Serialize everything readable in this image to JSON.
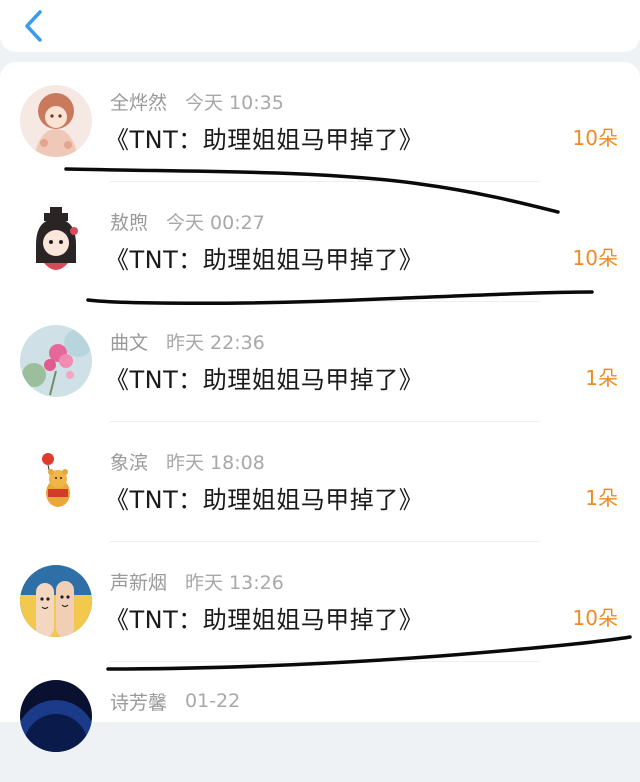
{
  "header": {
    "back_icon": "chevron-left-icon",
    "accent_color": "#3a9bf0"
  },
  "rows": [
    {
      "user": "全烨然",
      "time": "今天 10:35",
      "title": "《TNT：助理姐姐马甲掉了》",
      "count": "10朵",
      "avatar": "anime-girl-avatar"
    },
    {
      "user": "敖煦",
      "time": "今天 00:27",
      "title": "《TNT：助理姐姐马甲掉了》",
      "count": "10朵",
      "avatar": "chibi-girl-avatar"
    },
    {
      "user": "曲文",
      "time": "昨天 22:36",
      "title": "《TNT：助理姐姐马甲掉了》",
      "count": "1朵",
      "avatar": "pink-flower-avatar"
    },
    {
      "user": "象滨",
      "time": "昨天 18:08",
      "title": "《TNT：助理姐姐马甲掉了》",
      "count": "1朵",
      "avatar": "winnie-pooh-avatar"
    },
    {
      "user": "声新烟",
      "time": "昨天 13:26",
      "title": "《TNT：助理姐姐马甲掉了》",
      "count": "10朵",
      "avatar": "finger-faces-avatar"
    },
    {
      "user": "诗芳馨",
      "time": "01-22",
      "title": "",
      "count": "",
      "avatar": "night-sky-avatar"
    }
  ],
  "colors": {
    "count": "#f08a24",
    "username": "#9a9a9a",
    "title": "#1a1a1a",
    "background": "#eff2f5"
  }
}
